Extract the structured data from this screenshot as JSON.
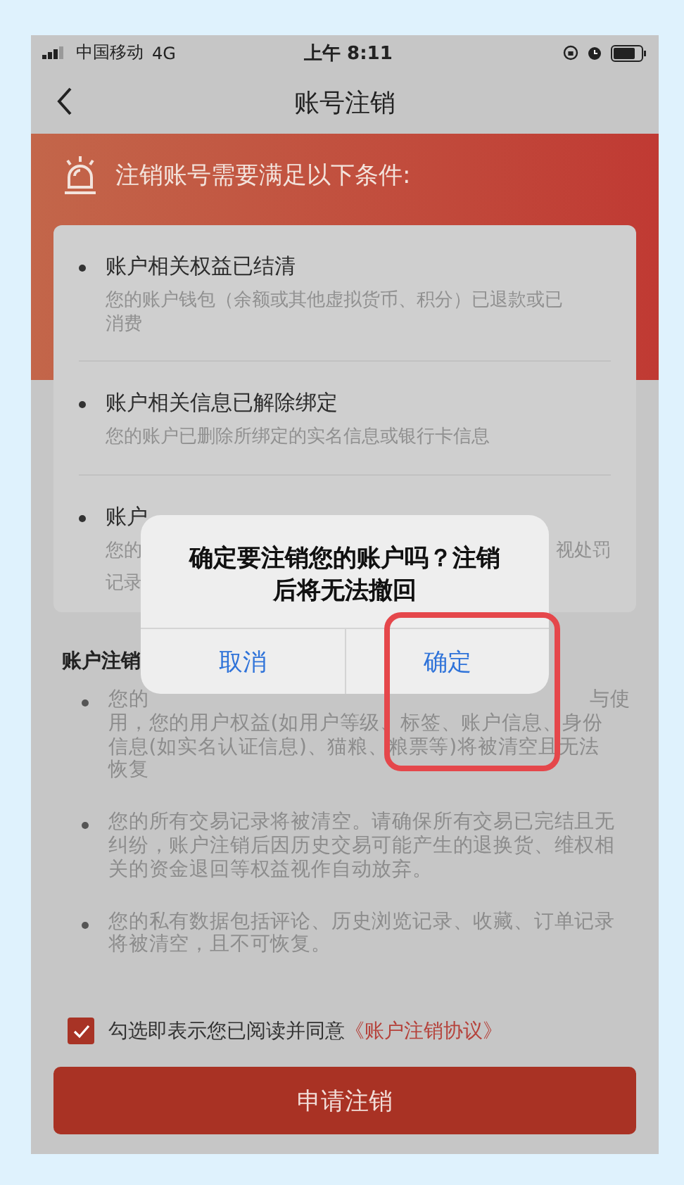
{
  "status_bar": {
    "carrier": "中国移动",
    "network": "4G",
    "time": "上午 8:11"
  },
  "nav": {
    "title": "账号注销"
  },
  "banner": {
    "title": "注销账号需要满足以下条件:"
  },
  "conditions": [
    {
      "kind": "full",
      "title": "账户相关权益已结清",
      "description": "您的账户钱包（余额或其他虚拟货币、积分）已退款或已消费"
    },
    {
      "kind": "full",
      "title": "账户相关信息已解除绑定",
      "description": "您的账户已删除所绑定的实名信息或银行卡信息"
    },
    {
      "kind": "covered",
      "title": "账户",
      "description_lines": [
        [
          "您的",
          "视处罚"
        ],
        [
          "记录"
        ]
      ]
    }
  ],
  "notice": {
    "heading": "账户注销",
    "bullets": [
      {
        "kind": "covered",
        "lines": [
          [
            "您的",
            "与使"
          ],
          [
            "用，您的用户权益(如用户等级、标签、账户信息、身份"
          ],
          [
            "信息(如实名认证信息)、猫粮、粮票等)将被清空且无法"
          ],
          [
            "恢复"
          ]
        ]
      },
      {
        "kind": "full",
        "text": "您的所有交易记录将被清空。请确保所有交易已完结且无纠纷，账户注销后因历史交易可能产生的退换货、维权相关的资金退回等权益视作自动放弃。"
      },
      {
        "kind": "full",
        "text": "您的私有数据包括评论、历史浏览记录、收藏、订单记录将被清空，且不可恢复。"
      }
    ]
  },
  "agreement": {
    "checked": true,
    "text": "勾选即表示您已阅读并同意",
    "link": "《账户注销协议》"
  },
  "submit_button": "申请注销",
  "dialog": {
    "message": "确定要注销您的账户吗？注销后将无法撤回",
    "buttons": [
      "取消",
      "确定"
    ]
  }
}
